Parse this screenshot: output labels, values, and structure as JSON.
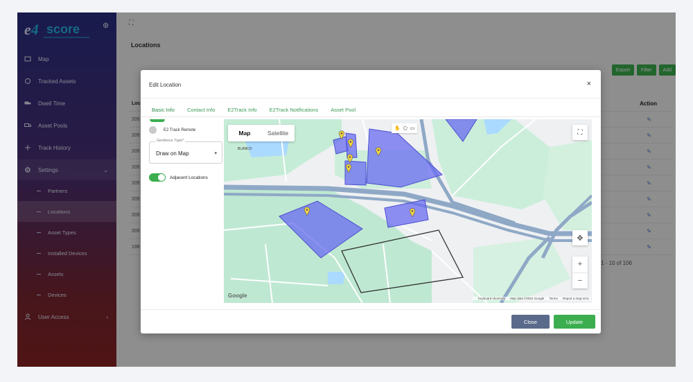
{
  "app": {
    "logo_text": "e4score"
  },
  "sidebar": {
    "items": [
      {
        "label": "Map",
        "icon": "map-icon"
      },
      {
        "label": "Tracked Assets",
        "icon": "tracked-assets-icon"
      },
      {
        "label": "Dwell Time",
        "icon": "truck-icon"
      },
      {
        "label": "Asset Pools",
        "icon": "truck-icon"
      },
      {
        "label": "Track History",
        "icon": "history-icon"
      },
      {
        "label": "Settings",
        "icon": "gear-icon"
      }
    ],
    "sub_items": [
      "Partners",
      "Locations",
      "Asset Types",
      "Installed Devices",
      "Assets",
      "Devices"
    ],
    "user_access": "User Access"
  },
  "page": {
    "title": "Locations",
    "buttons": [
      "Export",
      "Filter",
      "Add"
    ],
    "table_head": "Location",
    "table_action": "Action",
    "rows": [
      "205",
      "205",
      "205",
      "205",
      "205",
      "205",
      "205",
      "205",
      "196"
    ],
    "pagination": "1 - 10 of 106"
  },
  "modal": {
    "title": "Edit Location",
    "tabs": [
      "Basic Info",
      "Contact Info",
      "E2Track Info",
      "E2Track Notifications",
      "Asset Pool"
    ],
    "radio_label": "E2 Track Remote",
    "geofence_label": "Geofence Type*",
    "geofence_value": "Draw on Map",
    "toggle_label": "Adjacent Locations",
    "map": {
      "type_map": "Map",
      "type_satellite": "Satellite",
      "google": "Google",
      "attribution": [
        "Keyboard shortcuts",
        "Map data ©2024 Google",
        "Terms",
        "Report a map error"
      ],
      "label_blanco": "BLANCO"
    },
    "close_label": "Close",
    "update_label": "Update"
  },
  "colors": {
    "accent": "#3cae4f",
    "polygon": "#6a6cf0",
    "sidebar_top": "#2b2f86",
    "sidebar_bottom": "#8a2424"
  }
}
